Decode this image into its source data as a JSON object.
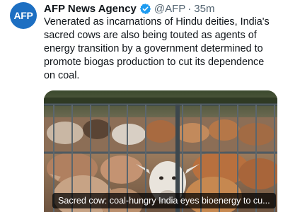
{
  "tweet": {
    "avatar_text": "AFP",
    "author_name": "AFP News Agency",
    "handle": "@AFP",
    "separator": "·",
    "time": "35m",
    "text": "Venerated as incarnations of Hindu deities, India's sacred cows are also being touted as agents of energy transition by a government determined to promote biogas production to cut its dependence on coal.",
    "link_card": {
      "caption": "Sacred cow: coal-hungry India eyes bioenergy to cu..."
    }
  },
  "colors": {
    "avatar_bg": "#1d6fc2",
    "verified_blue": "#1d9bf0",
    "text_primary": "#0f1419",
    "text_secondary": "#536471"
  },
  "icons": {
    "verified": "verified-badge-icon"
  }
}
